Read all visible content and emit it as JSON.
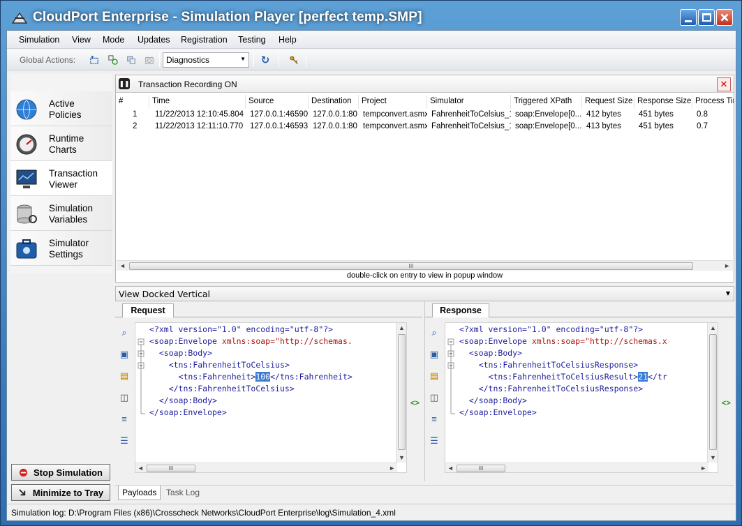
{
  "window": {
    "title": "CloudPort Enterprise - Simulation Player [perfect temp.SMP]"
  },
  "menu": [
    "Simulation",
    "View",
    "Mode",
    "Updates",
    "Registration",
    "Testing",
    "Help"
  ],
  "toolbar": {
    "label": "Global Actions:",
    "dropdown_value": "Diagnostics"
  },
  "nav": {
    "items": [
      {
        "line1": "Active",
        "line2": "Policies"
      },
      {
        "line1": "Runtime",
        "line2": "Charts"
      },
      {
        "line1": "Transaction",
        "line2": "Viewer"
      },
      {
        "line1": "Simulation",
        "line2": "Variables"
      },
      {
        "line1": "Simulator",
        "line2": "Settings"
      }
    ],
    "stop_button": "Stop Simulation",
    "minimize_button": "Minimize to Tray"
  },
  "recording": {
    "status": "Transaction Recording ON"
  },
  "grid": {
    "headers": [
      "#",
      "Time",
      "Source",
      "Destination",
      "Project",
      "Simulator",
      "Triggered XPath",
      "Request Size",
      "Response Size",
      "Process Tim"
    ],
    "rows": [
      [
        "1",
        "11/22/2013 12:10:45.804",
        "127.0.0.1:46590",
        "127.0.0.1:80",
        "tempconvert.asmx",
        "FahrenheitToCelsius_1",
        "soap:Envelope[0...",
        "412 bytes",
        "451 bytes",
        "0.8"
      ],
      [
        "2",
        "11/22/2013 12:11:10.770",
        "127.0.0.1:46593",
        "127.0.0.1:80",
        "tempconvert.asmx",
        "FahrenheitToCelsius_1",
        "soap:Envelope[0...",
        "413 bytes",
        "451 bytes",
        "0.7"
      ]
    ],
    "hint": "double-click on entry to view in popup window"
  },
  "view_dropdown": "View Docked Vertical",
  "request": {
    "tab": "Request",
    "pi": "<?xml version=\"1.0\" encoding=\"utf-8\"?>",
    "env_open": "<soap:Envelope",
    "env_attr": " xmlns:soap=\"http://schemas.",
    "body_open": "<soap:Body>",
    "op_open": "<tns:FahrenheitToCelsius>",
    "param_open": "<tns:Fahrenheit>",
    "param_value": "100",
    "param_close": "</tns:Fahrenheit>",
    "op_close": "</tns:FahrenheitToCelsius>",
    "body_close": "</soap:Body>",
    "env_close": "</soap:Envelope>"
  },
  "response": {
    "tab": "Response",
    "pi": "<?xml version=\"1.0\" encoding=\"utf-8\"?>",
    "env_open": "<soap:Envelope",
    "env_attr": " xmlns:soap=\"http://schemas.x",
    "body_open": "<soap:Body>",
    "op_open": "<tns:FahrenheitToCelsiusResponse>",
    "param_open": "<tns:FahrenheitToCelsiusResult>",
    "param_value": "21",
    "param_close": "</tr",
    "op_close": "</tns:FahrenheitToCelsiusResponse>",
    "body_close": "</soap:Body>",
    "env_close": "</soap:Envelope>"
  },
  "bottom_tabs": [
    "Payloads",
    "Task Log"
  ],
  "status": "Simulation log: D:\\Program Files (x86)\\Crosscheck Networks\\CloudPort Enterprise\\log\\Simulation_4.xml",
  "icons": {
    "sync": "sync-arrows-icon",
    "scroll_thumb": "grip-icon"
  },
  "glyphs": {
    "sync": "<>",
    "grip": "III",
    "left": "◄",
    "right": "►",
    "up": "▲",
    "down": "▼",
    "dropdown": "▼",
    "close": "✕",
    "pause": "❚❚",
    "refresh": "↻",
    "collapse": "−"
  }
}
